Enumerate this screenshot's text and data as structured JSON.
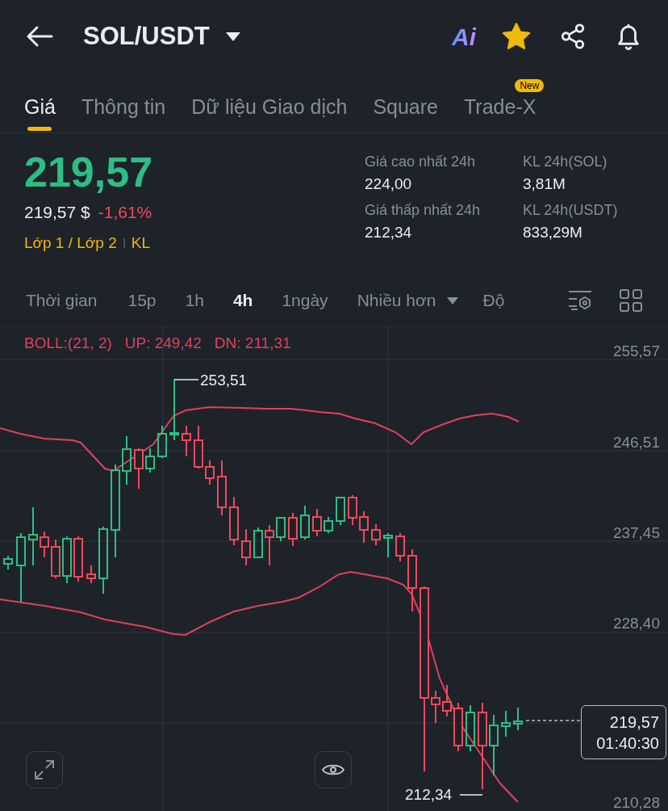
{
  "header": {
    "title": "SOL/USDT",
    "ai_label": "Ai",
    "favorite": true
  },
  "tabs": [
    {
      "label": "Giá",
      "selected": true
    },
    {
      "label": "Thông tin",
      "selected": false
    },
    {
      "label": "Dữ liệu Giao dịch",
      "selected": false
    },
    {
      "label": "Square",
      "selected": false
    },
    {
      "label": "Trade-X",
      "selected": false,
      "badge": "New"
    }
  ],
  "price": {
    "last": "219,57",
    "fiat": "219,57 $",
    "change": "-1,61%",
    "tags": [
      "Lớp 1 / Lớp 2",
      "KL"
    ]
  },
  "stats": [
    {
      "label": "Giá cao nhất 24h",
      "value": "224,00"
    },
    {
      "label": "KL 24h(SOL)",
      "value": "3,81M"
    },
    {
      "label": "Giá thấp nhất 24h",
      "value": "212,34"
    },
    {
      "label": "KL 24h(USDT)",
      "value": "833,29M"
    }
  ],
  "interval_bar": {
    "time_label": "Thời gian",
    "intervals": [
      {
        "label": "15p",
        "selected": false
      },
      {
        "label": "1h",
        "selected": false
      },
      {
        "label": "4h",
        "selected": true
      },
      {
        "label": "1ngày",
        "selected": false
      }
    ],
    "more": "Nhiều hơn",
    "depth": "Độ"
  },
  "chart": {
    "indicator": "BOLL:(21, 2)",
    "upper": "UP: 249,42",
    "lower": "DN: 211,31",
    "price_axis": [
      "255,57",
      "246,51",
      "237,45",
      "228,40",
      "210,28"
    ],
    "high_label": "253,51",
    "low_label": "212,34",
    "last_price": "219,57",
    "countdown": "01:40:30"
  }
}
